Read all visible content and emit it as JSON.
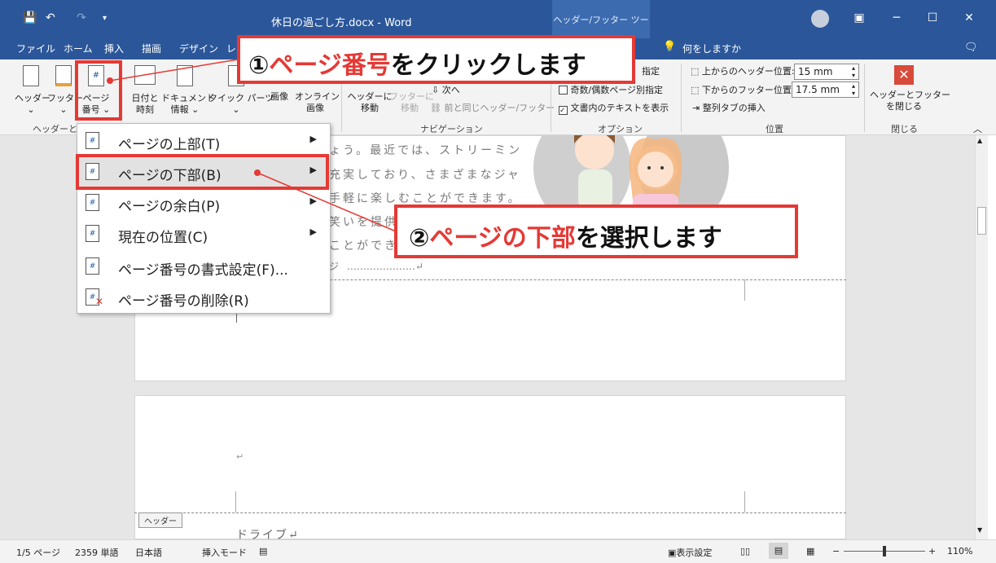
{
  "title_bar": {
    "document_title": "休日の過ごし方.docx - Word",
    "context_tab": "ヘッダー/フッター ツール",
    "qat_icons": [
      "save-icon",
      "undo-icon",
      "redo-icon",
      "customize-icon"
    ]
  },
  "tabs": [
    "ファイル",
    "ホーム",
    "挿入",
    "描画",
    "デザイン",
    "レ"
  ],
  "tell_me": "何をしますか",
  "ribbon": {
    "header_label": "ヘッダー",
    "footer_label": "フッター",
    "page_number_label_1": "ページ",
    "page_number_label_2": "番号",
    "group_header_footer": "ヘッダーとフ",
    "date_time_1": "日付と",
    "date_time_2": "時刻",
    "doc_info_1": "ドキュメント",
    "doc_info_2": "情報",
    "quick_parts": "クイック パーツ",
    "picture": "画像",
    "online_1": "オンライン",
    "online_2": "画像",
    "goto_header_1": "ヘッダーに",
    "goto_header_2": "移動",
    "goto_footer_1": "フッターに",
    "goto_footer_2": "移動",
    "next": "次へ",
    "link_previous": "前と同じヘッダー/フッター",
    "group_navigation": "ナビゲーション",
    "opt_first_page": "指定",
    "opt_odd_even": "奇数/偶数ページ別指定",
    "opt_show_text": "文書内のテキストを表示",
    "group_options": "オプション",
    "header_pos_label": "上からのヘッダー位置:",
    "header_pos_value": "15 mm",
    "footer_pos_label": "下からのフッター位置:",
    "footer_pos_value": "17.5 mm",
    "insert_tab": "整列タブの挿入",
    "group_position": "位置",
    "close_1": "ヘッダーとフッター",
    "close_2": "を閉じる",
    "group_close": "閉じる"
  },
  "menu": {
    "items": [
      {
        "label": "ページの上部(T)",
        "icon": "page-top-icon",
        "submenu": true
      },
      {
        "label": "ページの下部(B)",
        "icon": "page-bottom-icon",
        "submenu": true
      },
      {
        "label": "ページの余白(P)",
        "icon": "page-margin-icon",
        "submenu": true
      },
      {
        "label": "現在の位置(C)",
        "icon": "current-position-icon",
        "submenu": true
      },
      {
        "label": "ページ番号の書式設定(F)...",
        "icon": "format-page-number-icon",
        "submenu": false
      },
      {
        "label": "ページ番号の削除(R)",
        "icon": "remove-page-number-icon",
        "submenu": false
      }
    ]
  },
  "document": {
    "line1": "ょう。最近では、ストリーミン",
    "line2": "充実しており、さまざまなジャ",
    "line3": "手軽に楽しむことができます。",
    "line4": "笑いを提供",
    "line5": "ことができ",
    "line6": "ジ",
    "header_tag": "ヘッダー",
    "page2_heading": "ドライブ↵",
    "paragraph_mark": "↵"
  },
  "callouts": {
    "c1_num": "①",
    "c1_red": "ページ番号",
    "c1_rest": "をクリックします",
    "c2_num": "②",
    "c2_red": "ページの下部",
    "c2_rest": "を選択します"
  },
  "status": {
    "page": "1/5 ページ",
    "words": "2359 単語",
    "lang": "日本語",
    "mode": "挿入モード",
    "display": "表示設定",
    "zoom": "110%"
  },
  "colors": {
    "accent": "#2b579a",
    "highlight": "#e53935"
  }
}
